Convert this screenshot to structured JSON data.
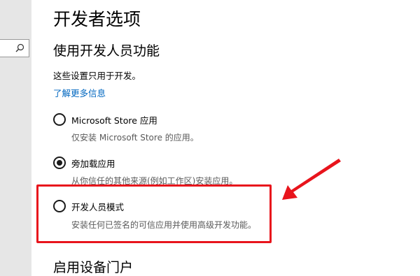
{
  "page_title": "开发者选项",
  "section_title": "使用开发人员功能",
  "description": "这些设置只用于开发。",
  "learn_more_link": "了解更多信息",
  "options": [
    {
      "label": "Microsoft Store 应用",
      "description": "仅安装 Microsoft Store 的应用。",
      "checked": false
    },
    {
      "label": "旁加载应用",
      "description": "从你信任的其他来源(例如工作区)安装应用。",
      "checked": true
    },
    {
      "label": "开发人员模式",
      "description": "安装任何已签名的可信应用并使用高级开发功能。",
      "checked": false
    }
  ],
  "next_section_title": "启用设备门户",
  "colors": {
    "accent_link": "#0067c0",
    "annotation_red": "#e8141c"
  },
  "icons": {
    "search": "search-icon"
  }
}
